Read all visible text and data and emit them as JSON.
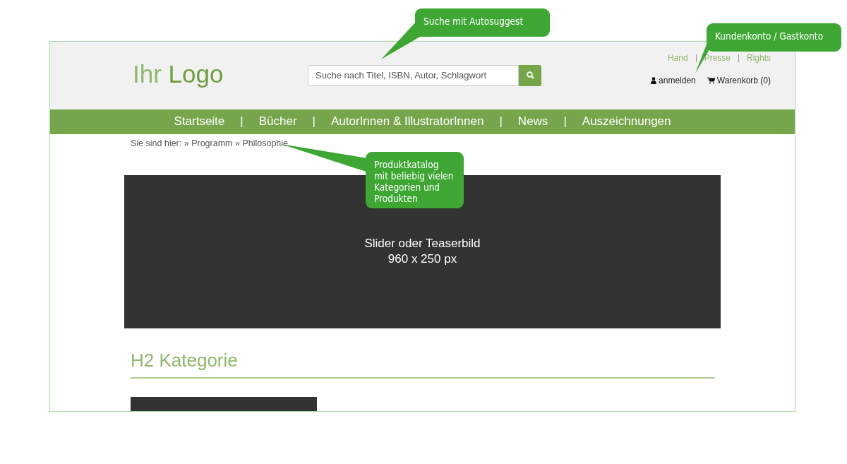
{
  "header": {
    "top_links": [
      "Hand",
      "Presse",
      "Rights"
    ],
    "logo": "Ihr **Logo**",
    "search": {
      "placeholder": "Suche nach Titel, ISBN, Autor, Schlagwort"
    },
    "account_link": "anmelden",
    "cart_link": "Warenkorb (0)"
  },
  "nav": {
    "items": [
      "Startseite",
      "Bücher",
      "AutorInnen & IllustratorInnen",
      "News",
      "Auszeichnungen"
    ],
    "separator": "|"
  },
  "breadcrumb": "Sie sind hier: » Programm » Philosophie",
  "slider": {
    "lines": [
      "Slider oder Teaserbild",
      "960 x 250 px"
    ]
  },
  "category_heading": "H2 Kategorie",
  "callouts": [
    {
      "text": "Suche mit Autosuggest"
    },
    {
      "text": "Kundenkonto / Gastkonto"
    },
    {
      "text": "Produktkatalog mit beliebig vielen Kategorien und Produkten"
    }
  ]
}
